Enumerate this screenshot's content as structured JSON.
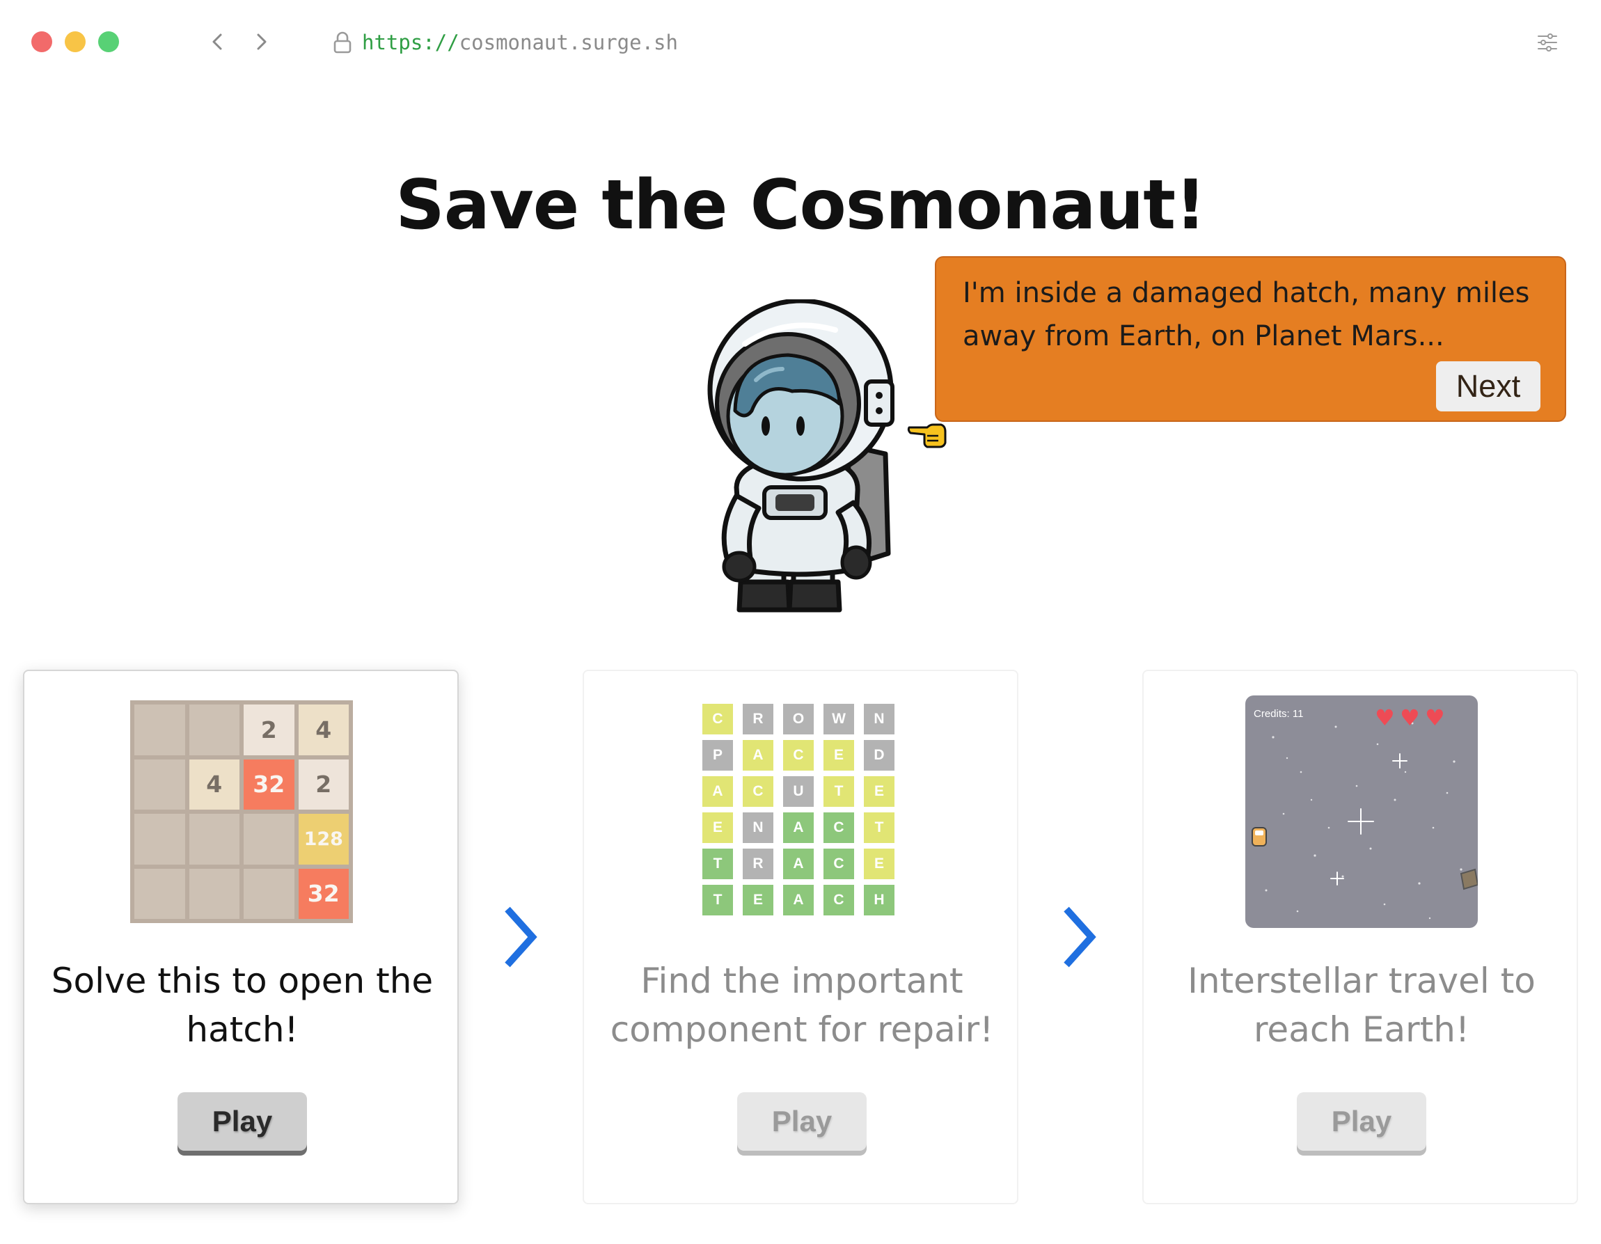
{
  "browser": {
    "url_scheme": "https://",
    "url_host": "cosmonaut.surge.sh"
  },
  "page": {
    "title": "Save the Cosmonaut!"
  },
  "bubble": {
    "text": "I'm inside a damaged hatch, many miles away from Earth, on Planet Mars...",
    "next_label": "Next"
  },
  "levels": [
    {
      "description": "Solve this to open the hatch!",
      "play_label": "Play",
      "state": "unlocked"
    },
    {
      "description": "Find the important component for repair!",
      "play_label": "Play",
      "state": "locked"
    },
    {
      "description": "Interstellar travel to reach Earth!",
      "play_label": "Play",
      "state": "locked"
    }
  ],
  "game_2048": {
    "tiles": [
      "",
      "",
      "2",
      "4",
      "",
      "4",
      "32",
      "2",
      "",
      "",
      "",
      "128",
      "",
      "",
      "",
      "32"
    ]
  },
  "word_grid": {
    "rows": [
      [
        "C",
        "R",
        "O",
        "W",
        "N"
      ],
      [
        "P",
        "A",
        "C",
        "E",
        "D"
      ],
      [
        "A",
        "C",
        "U",
        "T",
        "E"
      ],
      [
        "E",
        "N",
        "A",
        "C",
        "T"
      ],
      [
        "T",
        "R",
        "A",
        "C",
        "E"
      ],
      [
        "T",
        "E",
        "A",
        "C",
        "H"
      ]
    ],
    "colors": [
      [
        "yellow",
        "gray",
        "gray",
        "gray",
        "gray"
      ],
      [
        "gray",
        "yellow",
        "yellow",
        "yellow",
        "gray"
      ],
      [
        "yellow",
        "yellow",
        "gray",
        "yellow",
        "yellow"
      ],
      [
        "yellow",
        "gray",
        "green",
        "green",
        "yellow"
      ],
      [
        "green",
        "gray",
        "green",
        "green",
        "yellow"
      ],
      [
        "green",
        "green",
        "green",
        "green",
        "green"
      ]
    ],
    "palette": {
      "green": "#8dc77b",
      "yellow": "#e1e574",
      "gray": "#b3b3b3"
    }
  },
  "space_game": {
    "credits_text": "Credits: 11",
    "lives": 3
  },
  "colors": {
    "bubble": "#e57e22",
    "chevron": "#1f6fe0",
    "heart": "#ee4b55"
  },
  "icons": {
    "back": "chevron-left-icon",
    "forward": "chevron-right-icon",
    "lock": "lock-icon",
    "settings": "sliders-icon",
    "next_step": "chevron-right-icon",
    "pointer": "pointing-hand-icon"
  }
}
